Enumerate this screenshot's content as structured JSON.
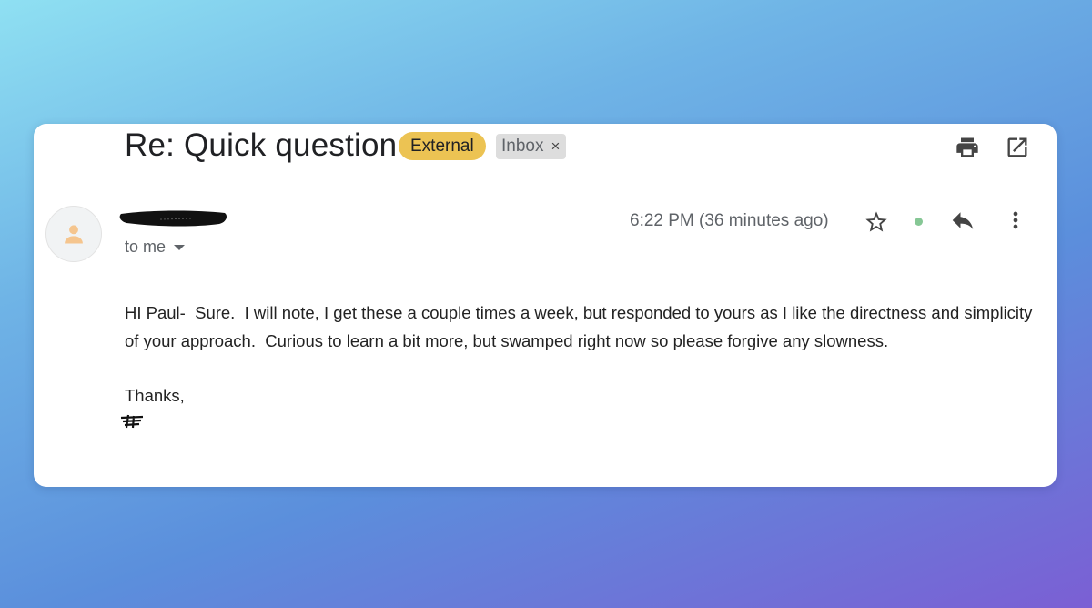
{
  "email": {
    "subject": "Re: Quick question",
    "labels": {
      "external": "External",
      "inbox": "Inbox",
      "inbox_remove": "×"
    },
    "toolbar_icons": [
      "print-icon",
      "open-in-new-window-icon"
    ],
    "recipient": "to me",
    "timestamp": "6:22 PM (36 minutes ago)",
    "action_icons": [
      "star-icon",
      "status-dot",
      "reply-icon",
      "more-vert-icon"
    ],
    "body": {
      "paragraph": "HI Paul-  Sure.  I will note, I get these a couple times a week, but responded to yours as I like the directness and simplicity of your approach.  Curious to learn a bit more, but swamped right now so please forgive any slowness.",
      "closing": "Thanks,"
    }
  },
  "colors": {
    "external_label": "#ecc353",
    "inbox_label": "#dddddd",
    "status_dot": "#86c795",
    "avatar_person": "#f5c58e"
  }
}
